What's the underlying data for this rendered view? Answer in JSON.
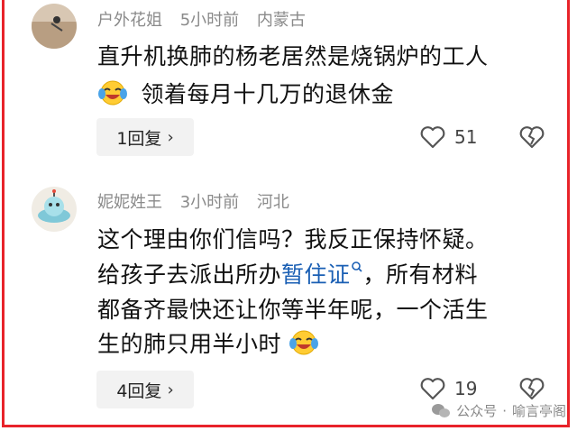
{
  "comments": [
    {
      "username": "户外花姐",
      "time": "5小时前",
      "location": "内蒙古",
      "line1": "直升机换肺的杨老居然是烧锅炉的工人",
      "line2": "领着每月十几万的退休金",
      "reply_label": "1回复",
      "like_count": "51"
    },
    {
      "username": "妮妮姓王",
      "time": "3小时前",
      "location": "河北",
      "line1": "这个理由你们信吗？我反正保持怀疑。",
      "line2_pre": "给孩子去派出所办",
      "line2_link": "暂住证",
      "line2_post": "，所有材料",
      "line3": "都备齐最快还让你等半年呢，一个活生",
      "line4": "生的肺只用半小时",
      "reply_label": "4回复",
      "like_count": "19"
    }
  ],
  "watermark": {
    "label": "公众号",
    "separator": "·",
    "name": "喻言亭阁"
  },
  "colors": {
    "frame": "#e8232a",
    "link": "#1a5fb4",
    "meta": "#8a8a8a",
    "reply_bg": "#f2f2f2"
  },
  "icons": [
    "avatar",
    "laughing-crying-emoji",
    "search-icon",
    "heart-icon",
    "broken-heart-icon",
    "wechat-logo-icon",
    "chevron-right-icon"
  ]
}
